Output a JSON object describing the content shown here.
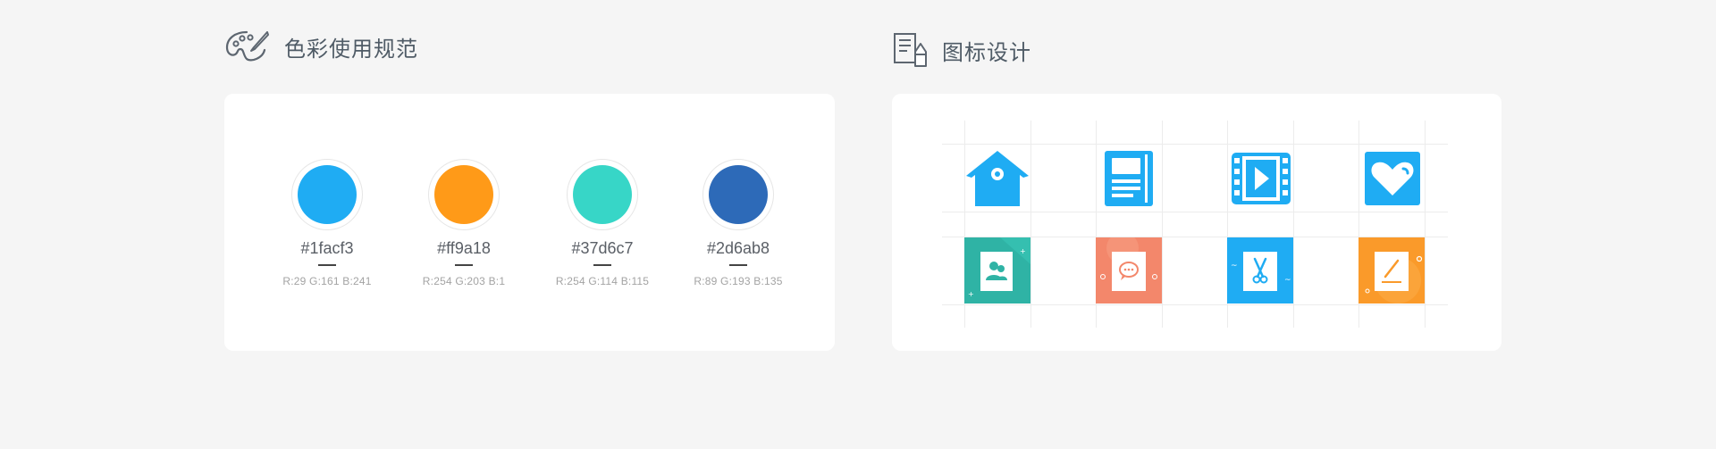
{
  "color_section": {
    "title": "色彩使用规范",
    "icon": "palette-icon",
    "swatches": [
      {
        "hex": "#1facf3",
        "rgb": "R:29   G:161   B:241",
        "color": "#1facf3"
      },
      {
        "hex": "#ff9a18",
        "rgb": "R:254  G:203  B:1",
        "color": "#ff9a18"
      },
      {
        "hex": "#37d6c7",
        "rgb": "R:254  G:114   B:115",
        "color": "#37d6c7"
      },
      {
        "hex": "#2d6ab8",
        "rgb": "R:89   G:193  B:135",
        "color": "#2d6ab8"
      }
    ]
  },
  "icon_section": {
    "title": "图标设计",
    "icon": "document-pencil-icon",
    "icons": [
      {
        "name": "house-icon",
        "bg": "#1facf3"
      },
      {
        "name": "notebook-icon",
        "bg": "#1facf3"
      },
      {
        "name": "video-play-icon",
        "bg": "#1facf3"
      },
      {
        "name": "heart-icon",
        "bg": "#1facf3"
      },
      {
        "name": "contacts-icon",
        "bg": "#2fb3a5"
      },
      {
        "name": "chat-bubble-icon",
        "bg": "#f3876b"
      },
      {
        "name": "scissors-icon",
        "bg": "#1facf3"
      },
      {
        "name": "pencil-edit-icon",
        "bg": "#fa9a2a"
      }
    ]
  }
}
